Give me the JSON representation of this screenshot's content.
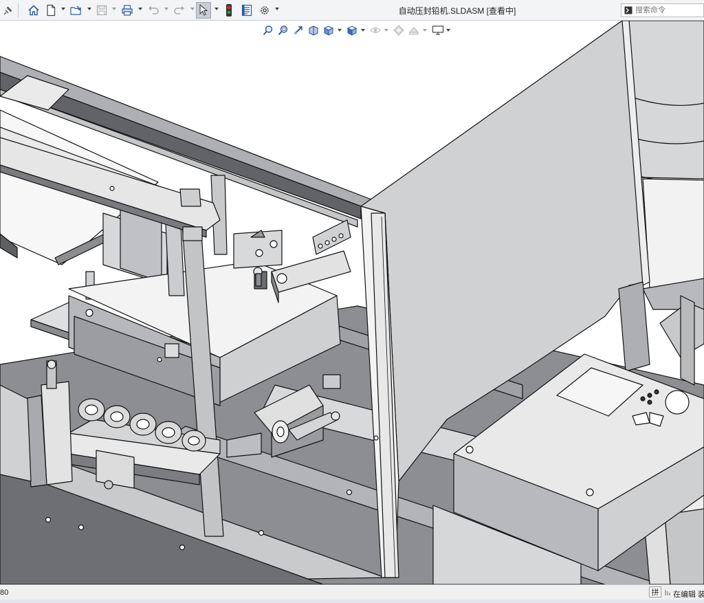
{
  "window": {
    "title": "自动压封铅机.SLDASM [查看中]"
  },
  "toolbar": {
    "items": [
      {
        "name": "pin-icon"
      },
      {
        "name": "home-icon"
      },
      {
        "name": "new-document-icon"
      },
      {
        "name": "open-folder-icon"
      },
      {
        "name": "save-icon"
      },
      {
        "name": "print-icon"
      },
      {
        "name": "undo-icon"
      },
      {
        "name": "redo-icon"
      },
      {
        "name": "select-pointer-icon",
        "state": "active"
      },
      {
        "name": "traffic-light-icon"
      },
      {
        "name": "file-properties-icon"
      },
      {
        "name": "gear-icon"
      }
    ]
  },
  "search": {
    "placeholder": "搜索命令"
  },
  "view_toolbar": {
    "items": [
      {
        "name": "zoom-to-fit-icon"
      },
      {
        "name": "zoom-to-area-icon"
      },
      {
        "name": "previous-view-icon"
      },
      {
        "name": "section-view-icon"
      },
      {
        "name": "view-orientation-icon"
      },
      {
        "name": "display-style-icon"
      },
      {
        "name": "hide-show-items-icon"
      },
      {
        "name": "edit-appearance-icon"
      },
      {
        "name": "apply-scene-icon"
      },
      {
        "name": "view-settings-icon"
      }
    ]
  },
  "status": {
    "coordinate": "80",
    "ime": "拼",
    "mode": "在编辑 装"
  },
  "colors": {
    "toolbar_bg": "#f3f4f6",
    "model_light": "#d3d4d6",
    "model_mid": "#a7a8ab",
    "model_dark": "#6e6f72",
    "edge": "#111111",
    "active_button": "#c9ccd3",
    "traffic_red": "#d9322b",
    "traffic_green": "#2e9d3a"
  }
}
